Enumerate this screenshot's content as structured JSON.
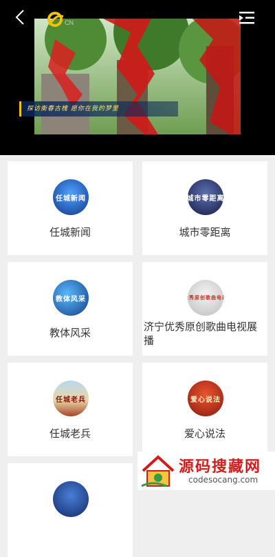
{
  "player": {
    "logo_text": "CN",
    "subtitle": "探访衡春古槐 愿你在我的梦里"
  },
  "icons": {
    "back": "chevron-left-icon",
    "menu": "playlist-menu-icon"
  },
  "channels": [
    {
      "label": "任城新闻",
      "thumb_text": "任城新闻",
      "color": "#1c4fb0"
    },
    {
      "label": "城市零距离",
      "thumb_text": "城市零距离",
      "color": "#1a2a5e"
    },
    {
      "label": "教体风采",
      "thumb_text": "教体风采",
      "color": "#1f5fa8"
    },
    {
      "label": "济宁优秀原创歌曲电视展播",
      "thumb_text": "济宁优秀原创歌曲电视展播",
      "color": "#d8d8d8"
    },
    {
      "label": "任城老兵",
      "thumb_text": "任城老兵",
      "color": "#c9a35a"
    },
    {
      "label": "爱心说法",
      "thumb_text": "爱心说法",
      "color": "#c0301c"
    },
    {
      "label": "",
      "thumb_text": "",
      "color": "#1c3f8f"
    }
  ],
  "watermark": {
    "title": "源码搜藏网",
    "url": "codesocang.com"
  }
}
